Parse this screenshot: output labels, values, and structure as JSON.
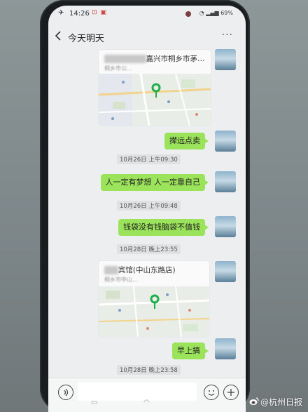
{
  "status": {
    "time": "14:26",
    "battery": "69%"
  },
  "chat": {
    "title": "今天明天"
  },
  "messages": [
    {
      "type": "location",
      "name_visible": "嘉兴市桐乡市茅…",
      "address_visible": "桐乡市公…"
    },
    {
      "type": "text",
      "text": "撵远点卖"
    },
    {
      "type": "timestamp",
      "text": "10月26日 上午09:30"
    },
    {
      "type": "text",
      "text": "人一定有梦想  人一定靠自己"
    },
    {
      "type": "timestamp",
      "text": "10月26日 上午09:48"
    },
    {
      "type": "text",
      "text": "钱袋没有钱脑袋不值钱"
    },
    {
      "type": "timestamp",
      "text": "10月28日 晚上23:55"
    },
    {
      "type": "location",
      "name_visible": "宾馆(中山东路店)",
      "address_visible": "桐乡市中山…"
    },
    {
      "type": "text",
      "text": "早上搞"
    },
    {
      "type": "timestamp",
      "text": "10月28日 晚上23:58"
    }
  ],
  "watermark": {
    "text": "@杭州日报"
  },
  "colors": {
    "bubble_green": "#9be35a",
    "screen_bg": "#eceeef",
    "map_pin": "#1fae4a"
  }
}
